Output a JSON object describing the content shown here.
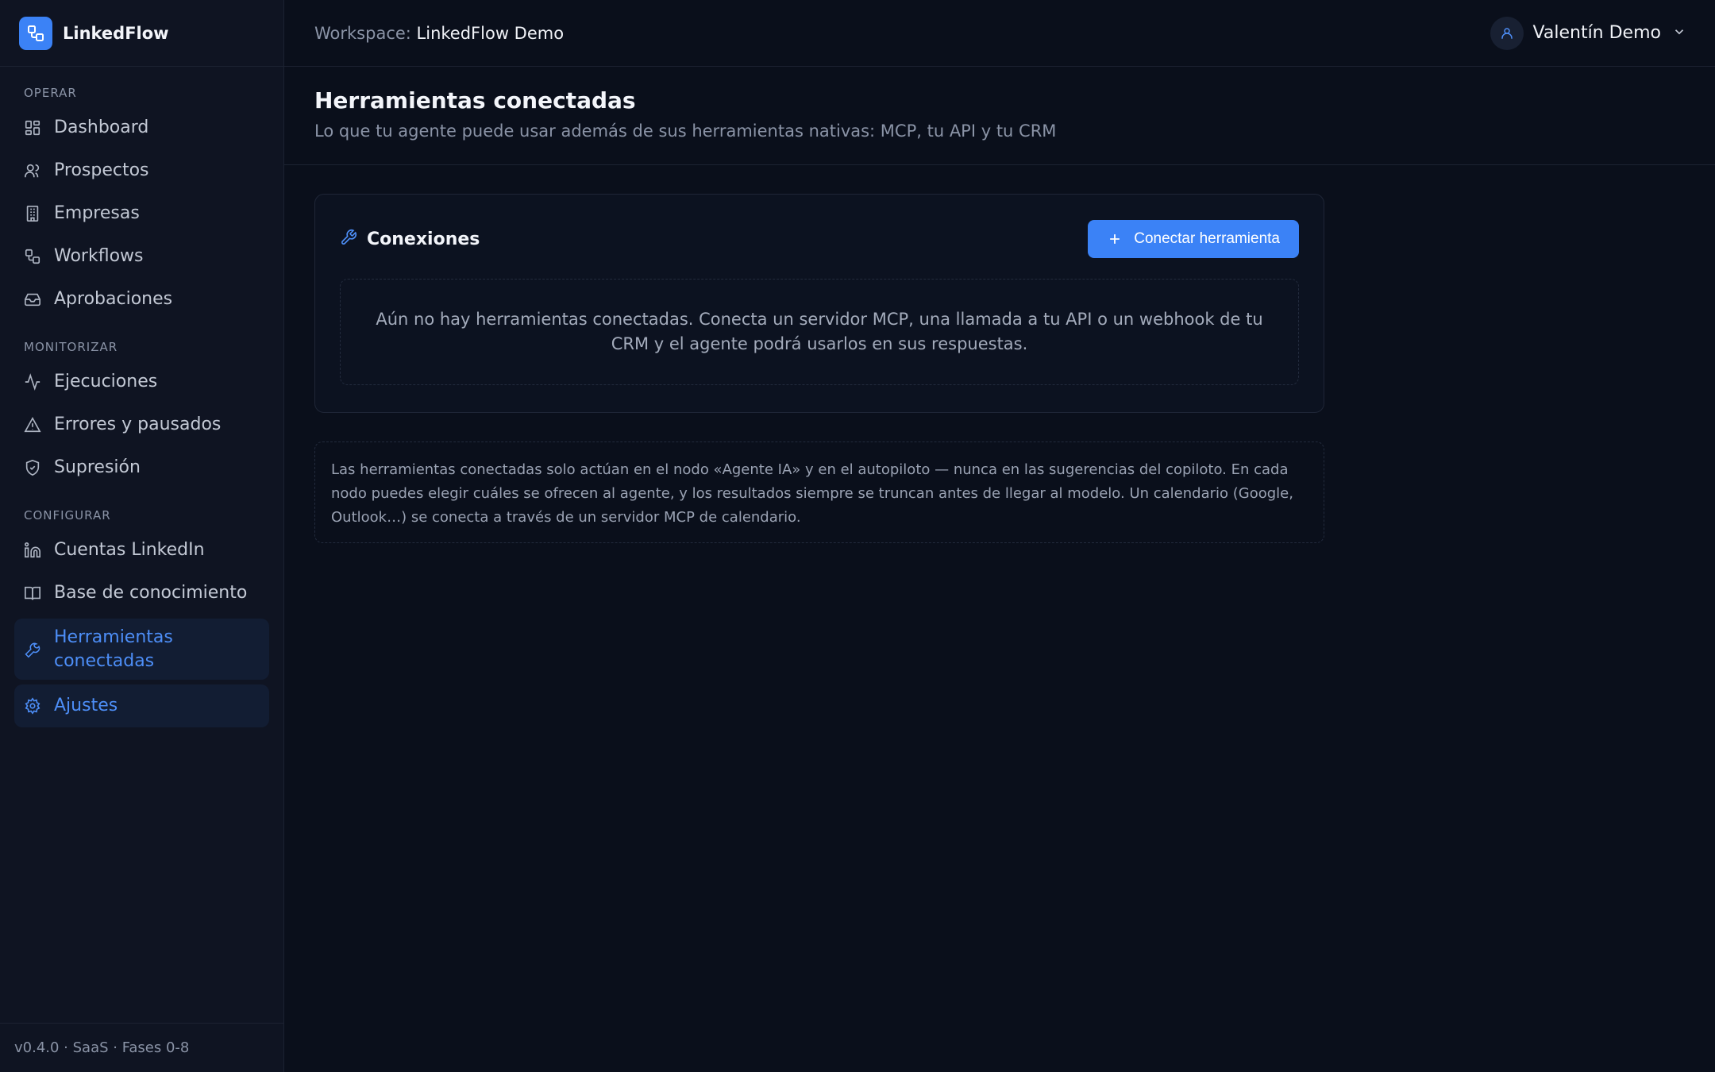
{
  "brand": {
    "name": "LinkedFlow",
    "accent": "#3b82f6"
  },
  "sidebar": {
    "sections": [
      {
        "label": "OPERAR",
        "items": [
          "Dashboard",
          "Prospectos",
          "Empresas",
          "Workflows",
          "Aprobaciones"
        ]
      },
      {
        "label": "MONITORIZAR",
        "items": [
          "Ejecuciones",
          "Errores y pausados",
          "Supresión"
        ]
      },
      {
        "label": "CONFIGURAR",
        "items": [
          "Cuentas LinkedIn",
          "Base de conocimiento",
          "Herramientas conectadas",
          "Ajustes"
        ]
      }
    ],
    "active_item": "Herramientas conectadas",
    "version": "v0.4.0 · SaaS · Fases 0-8"
  },
  "topbar": {
    "workspace_label": "Workspace:",
    "workspace_name": "LinkedFlow Demo",
    "user_name": "Valentín Demo"
  },
  "page": {
    "title": "Herramientas conectadas",
    "subtitle": "Lo que tu agente puede usar además de sus herramientas nativas: MCP, tu API y tu CRM"
  },
  "connections": {
    "title": "Conexiones",
    "button_label": "Conectar herramienta",
    "empty_text": "Aún no hay herramientas conectadas. Conecta un servidor MCP, una llamada a tu API o un webhook de tu CRM y el agente podrá usarlos en sus respuestas."
  },
  "note": "Las herramientas conectadas solo actúan en el nodo «Agente IA» y en el autopiloto — nunca en las sugerencias del copiloto. En cada nodo puedes elegir cuáles se ofrecen al agente, y los resultados siempre se truncan antes de llegar al modelo. Un calendario (Google, Outlook…) se conecta a través de un servidor MCP de calendario.",
  "icons": {
    "Dashboard": "layout-grid-icon",
    "Prospectos": "users-icon",
    "Empresas": "building-icon",
    "Workflows": "workflow-icon",
    "Aprobaciones": "inbox-icon",
    "Ejecuciones": "activity-icon",
    "Errores y pausados": "warning-icon",
    "Supresión": "shield-icon",
    "Cuentas LinkedIn": "linkedin-icon",
    "Base de conocimiento": "book-icon",
    "Herramientas conectadas": "wrench-icon",
    "Ajustes": "gear-icon"
  }
}
